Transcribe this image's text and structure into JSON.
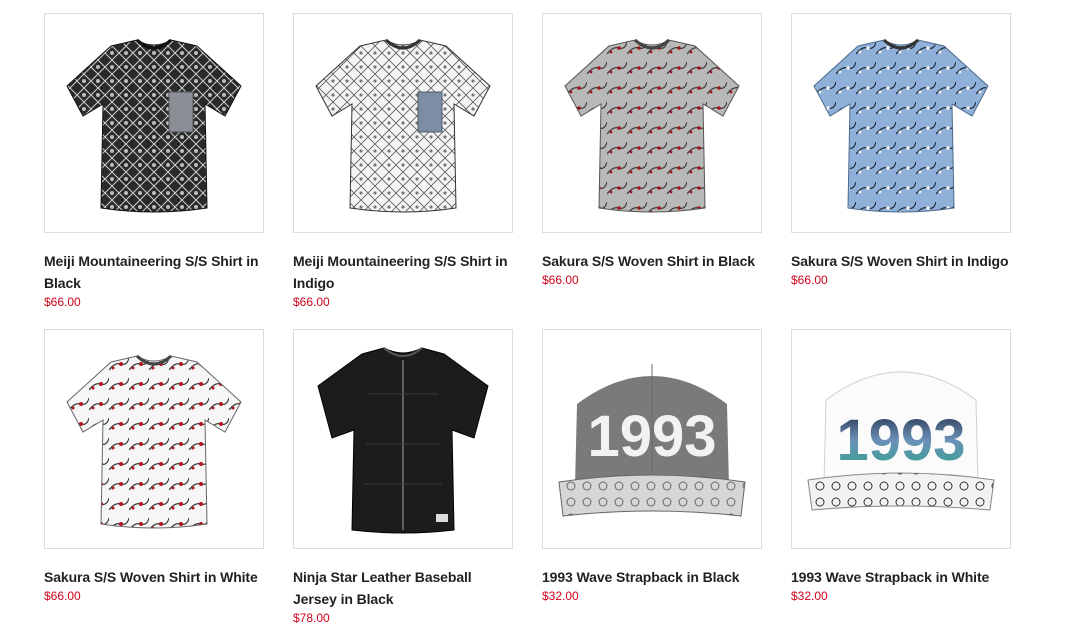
{
  "products": [
    {
      "title": "Meiji Mountaineering S/S Shirt in Black",
      "price": "$66.00",
      "image": "shirt-black-geometric-print"
    },
    {
      "title": "Meiji Mountaineering S/S Shirt in Indigo",
      "price": "$66.00",
      "image": "shirt-white-geometric-print"
    },
    {
      "title": "Sakura S/S Woven Shirt in Black",
      "price": "$66.00",
      "image": "shirt-grey-sakura-print"
    },
    {
      "title": "Sakura S/S Woven Shirt in Indigo",
      "price": "$66.00",
      "image": "shirt-blue-sakura-print"
    },
    {
      "title": "Sakura S/S Woven Shirt in White",
      "price": "$66.00",
      "image": "shirt-white-sakura-print"
    },
    {
      "title": "Ninja Star Leather Baseball Jersey in Black",
      "price": "$78.00",
      "image": "black-leather-jersey"
    },
    {
      "title": "1993 Wave Strapback in Black",
      "price": "$32.00",
      "image": "grey-cap-1993"
    },
    {
      "title": "1993 Wave Strapback in White",
      "price": "$32.00",
      "image": "white-cap-1993"
    }
  ],
  "cap_logo_text": "1993",
  "colors": {
    "price": "#d0021b",
    "title": "#222222",
    "border": "#dcdcdc"
  }
}
